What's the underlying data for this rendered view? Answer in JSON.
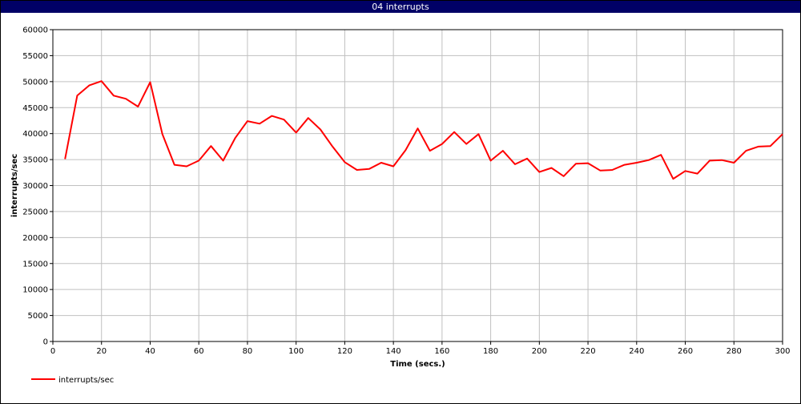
{
  "window": {
    "title": "04 interrupts"
  },
  "colors": {
    "series": "#ff0000",
    "grid": "#c0c0c0",
    "titlebar": "#000066"
  },
  "chart_data": {
    "type": "line",
    "title": "04 interrupts",
    "xlabel": "Time (secs.)",
    "ylabel": "interrupts/sec",
    "xlim": [
      0,
      300
    ],
    "ylim": [
      0,
      60000
    ],
    "xticks": [
      0,
      20,
      40,
      60,
      80,
      100,
      120,
      140,
      160,
      180,
      200,
      220,
      240,
      260,
      280,
      300
    ],
    "yticks": [
      0,
      5000,
      10000,
      15000,
      20000,
      25000,
      30000,
      35000,
      40000,
      45000,
      50000,
      55000,
      60000
    ],
    "grid": true,
    "legend": "bottom-left",
    "series": [
      {
        "name": "interrupts/sec",
        "color": "#ff0000",
        "x": [
          5,
          10,
          15,
          20,
          25,
          30,
          35,
          40,
          45,
          50,
          55,
          60,
          65,
          70,
          75,
          80,
          85,
          90,
          95,
          100,
          105,
          110,
          115,
          120,
          125,
          130,
          135,
          140,
          145,
          150,
          155,
          160,
          165,
          170,
          175,
          180,
          185,
          190,
          195,
          200,
          205,
          210,
          215,
          220,
          225,
          230,
          235,
          240,
          245,
          250,
          255,
          260,
          265,
          270,
          275,
          280,
          285,
          290,
          295,
          300
        ],
        "y": [
          35100,
          47300,
          49300,
          50100,
          47300,
          46700,
          45200,
          49900,
          39900,
          34000,
          33700,
          34800,
          37600,
          34800,
          39200,
          42400,
          41900,
          43400,
          42700,
          40200,
          43000,
          40800,
          37500,
          34500,
          33000,
          33200,
          34400,
          33700,
          36800,
          41000,
          36700,
          38000,
          40300,
          38000,
          39900,
          34800,
          36700,
          34100,
          35200,
          32600,
          33400,
          31800,
          34200,
          34300,
          32900,
          33000,
          34000,
          34400,
          34900,
          35900,
          31300,
          32800,
          32300,
          34800,
          34900,
          34400,
          36700,
          37500,
          37600,
          39900
        ]
      }
    ]
  }
}
